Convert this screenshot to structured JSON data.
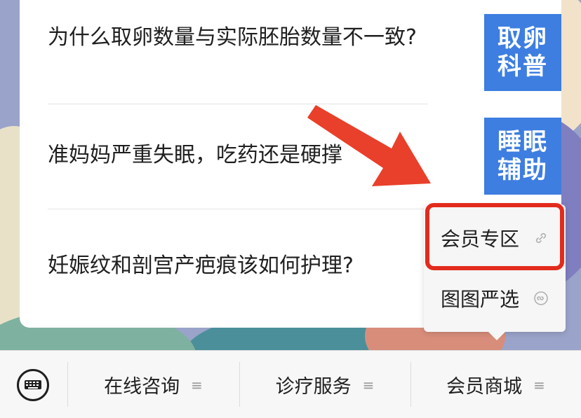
{
  "articles": [
    {
      "title": "为什么取卵数量与实际胚胎数量不一致?",
      "thumb_text": "取卵科普"
    },
    {
      "title": "准妈妈严重失眠，吃药还是硬撑",
      "thumb_text": "睡眠辅助"
    },
    {
      "title": "妊娠纹和剖宫产疤痕该如何护理?"
    }
  ],
  "popup_menu": {
    "items": [
      {
        "label": "会员专区",
        "icon": "link-icon"
      },
      {
        "label": "图图严选",
        "icon": "mini-program-icon"
      }
    ]
  },
  "bottom_tabs": [
    {
      "label": "在线咨询",
      "icon": "menu-icon"
    },
    {
      "label": "诊疗服务",
      "icon": "menu-icon"
    },
    {
      "label": "会员商城",
      "icon": "menu-icon"
    }
  ],
  "colors": {
    "accent": "#3d7ee0",
    "highlight": "#e22b1c"
  }
}
